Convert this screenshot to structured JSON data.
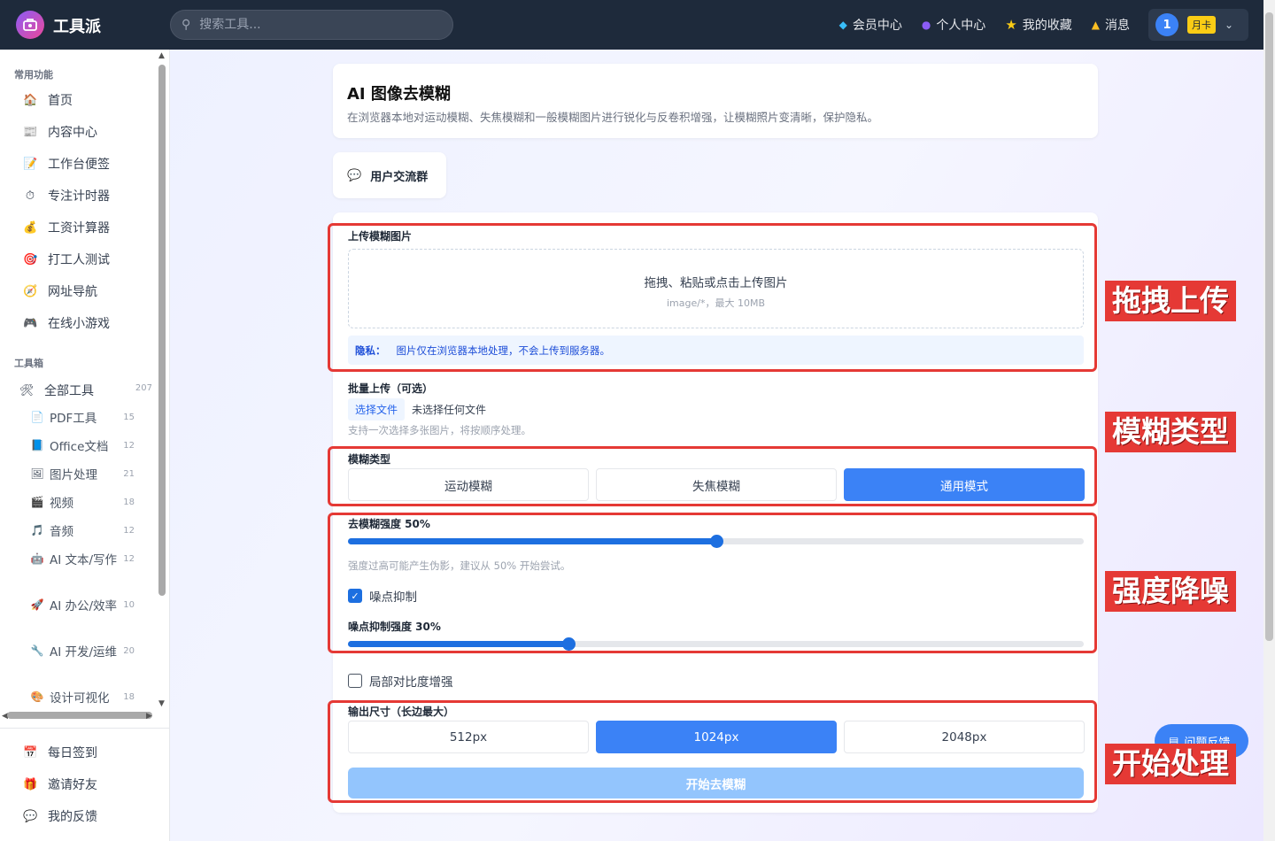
{
  "app": {
    "name": "工具派"
  },
  "search": {
    "placeholder": "搜索工具..."
  },
  "topnav": [
    {
      "label": "会员中心",
      "icon": "diamond-icon"
    },
    {
      "label": "个人中心",
      "icon": "person-icon"
    },
    {
      "label": "我的收藏",
      "icon": "star-icon"
    },
    {
      "label": "消息",
      "icon": "bell-icon"
    }
  ],
  "user": {
    "avatar": "1",
    "badge": "月卡"
  },
  "sidebar": {
    "common_title": "常用功能",
    "common": [
      {
        "label": "首页",
        "icon": "🏠"
      },
      {
        "label": "内容中心",
        "icon": "📰"
      },
      {
        "label": "工作台便签",
        "icon": "📝"
      },
      {
        "label": "专注计时器",
        "icon": "⏱"
      },
      {
        "label": "工资计算器",
        "icon": "💰"
      },
      {
        "label": "打工人测试",
        "icon": "🎯"
      },
      {
        "label": "网址导航",
        "icon": "🧭"
      },
      {
        "label": "在线小游戏",
        "icon": "🎮"
      }
    ],
    "toolbox_title": "工具箱",
    "all_tools": {
      "label": "全部工具",
      "icon": "🛠",
      "count": "207"
    },
    "tools": [
      {
        "label": "PDF工具",
        "icon": "📄",
        "count": "15"
      },
      {
        "label": "Office文档",
        "icon": "📘",
        "count": "12"
      },
      {
        "label": "图片处理",
        "icon": "🖼",
        "count": "21"
      },
      {
        "label": "视频",
        "icon": "🎬",
        "count": "18"
      },
      {
        "label": "音频",
        "icon": "🎵",
        "count": "12"
      },
      {
        "label": "AI 文本/写作",
        "icon": "🤖",
        "count": "12"
      },
      {
        "label": "AI 办公/效率",
        "icon": "🚀",
        "count": "10"
      },
      {
        "label": "AI 开发/运维",
        "icon": "🔧",
        "count": "20"
      },
      {
        "label": "设计可视化",
        "icon": "🎨",
        "count": "18"
      }
    ],
    "bottom": [
      {
        "label": "每日签到",
        "icon": "📅"
      },
      {
        "label": "邀请好友",
        "icon": "🎁"
      },
      {
        "label": "我的反馈",
        "icon": "💬"
      }
    ]
  },
  "page": {
    "title": "AI 图像去模糊",
    "desc": "在浏览器本地对运动模糊、失焦模糊和一般模糊图片进行锐化与反卷积增强，让模糊照片变清晰，保护隐私。",
    "group_btn": "用户交流群",
    "upload_label": "上传模糊图片",
    "drop_text": "拖拽、粘贴或点击上传图片",
    "drop_hint": "image/*，最大 10MB",
    "privacy_title": "隐私：",
    "privacy_text": "图片仅在浏览器本地处理，不会上传到服务器。",
    "batch_label": "批量上传（可选）",
    "choose_file": "选择文件",
    "no_file": "未选择任何文件",
    "batch_hint": "支持一次选择多张图片，将按顺序处理。",
    "blur_type_label": "模糊类型",
    "blur_types": [
      "运动模糊",
      "失焦模糊",
      "通用模式"
    ],
    "blur_active": 2,
    "strength_label": "去模糊强度 50%",
    "strength": 0.5,
    "strength_hint": "强度过高可能产生伪影，建议从 50% 开始尝试。",
    "denoise_label": "噪点抑制",
    "denoise_checked": true,
    "denoise_strength_label": "噪点抑制强度 30%",
    "denoise_strength": 0.3,
    "contrast_label": "局部对比度增强",
    "contrast_checked": false,
    "output_label": "输出尺寸（长边最大）",
    "output_sizes": [
      "512px",
      "1024px",
      "2048px"
    ],
    "output_active": 1,
    "start_btn": "开始去模糊",
    "feedback_btn": "问题反馈"
  },
  "annotations": [
    "拖拽上传",
    "模糊类型",
    "强度降噪",
    "开始处理"
  ],
  "colors": {
    "accent": "#3b82f6",
    "annotation": "#e53935",
    "topbar": "#1e2a3b"
  }
}
